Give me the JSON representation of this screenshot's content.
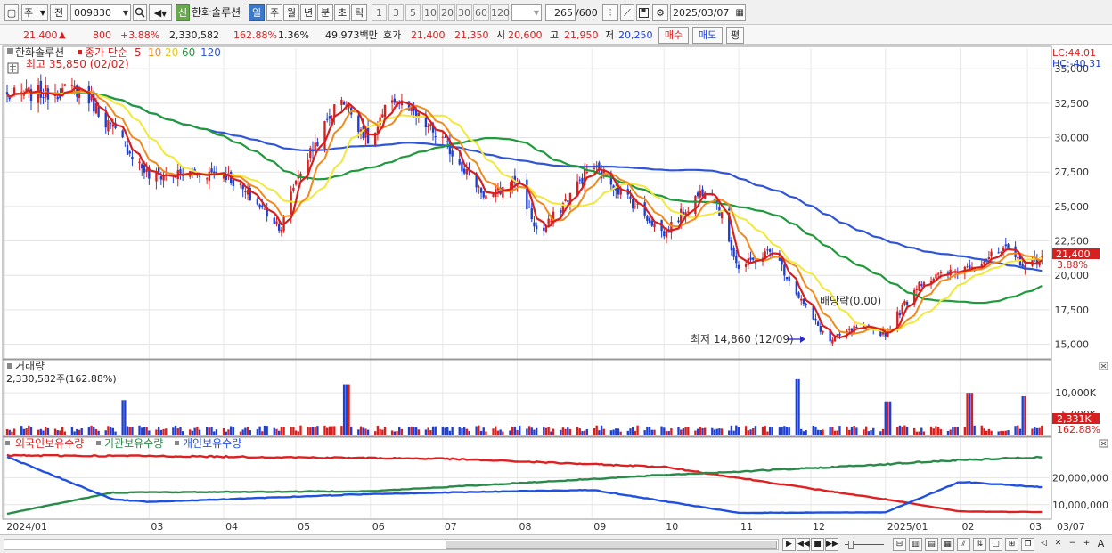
{
  "toolbar": {
    "period_select": "주",
    "prev_label": "전",
    "stock_code": "009830",
    "credit_badge": "신",
    "stock_name": "한화솔루션",
    "periods": [
      "일",
      "주",
      "월",
      "년",
      "분",
      "초",
      "틱"
    ],
    "active_period": "일",
    "intervals": [
      "1",
      "3",
      "5",
      "10",
      "20",
      "30",
      "60",
      "120"
    ],
    "count_value": "265",
    "count_total": "/600",
    "date": "2025/03/07"
  },
  "quote": {
    "price": "21,400",
    "change": "800",
    "change_pct": "+3.88%",
    "volume": "2,330,582",
    "volume_ratio": "162.88%",
    "turnover": "1.36%",
    "amount": "49,973백만",
    "bid_label": "호가",
    "bid1": "21,400",
    "bid2": "21,350",
    "open_label": "시",
    "open": "20,600",
    "high_label": "고",
    "high": "21,950",
    "low_label": "저",
    "low": "20,250",
    "buy_label": "매수",
    "sell_label": "매도",
    "eval_label": "평"
  },
  "price_panel": {
    "stock_label": "한화솔루션",
    "ma_label": "종가 단순",
    "ma_periods": [
      "5",
      "10",
      "20",
      "60",
      "120"
    ],
    "high_label": "최고 35,850 (02/02)",
    "low_label": "최저 14,860 (12/09)",
    "dividend_label": "배당락(0.00)",
    "lc_label": "LC:44.01",
    "hc_label": "HC:-40.31",
    "price_tag": "21,400",
    "pct_tag": "3.88%",
    "y_ticks": [
      "35,000",
      "32,500",
      "30,000",
      "27,500",
      "25,000",
      "22,500",
      "20,000",
      "17,500",
      "15,000"
    ]
  },
  "volume_panel": {
    "title": "거래량",
    "value_label": "2,330,582주(162.88%)",
    "y_ticks": [
      "10,000K",
      "5,000K"
    ],
    "tag": "2,331K",
    "tag_pct": "162.88%"
  },
  "holding_panel": {
    "series": [
      "외국인보유수량",
      "기관보유수량",
      "개인보유수량"
    ],
    "y_ticks": [
      "20,000,000",
      "10,000,000"
    ]
  },
  "x_axis": {
    "labels": [
      "2024/01",
      "03",
      "04",
      "05",
      "06",
      "07",
      "08",
      "09",
      "10",
      "11",
      "12",
      "2025/01",
      "02",
      "03",
      "03/07"
    ]
  },
  "colors": {
    "up": "#d62020",
    "down": "#1e3fd0",
    "ma5": "#d62020",
    "ma10": "#f08a1c",
    "ma20": "#f2e83a",
    "ma60": "#1f9a3c",
    "ma120": "#3055d6",
    "foreign": "#e02020",
    "institution": "#2a8a4a",
    "individual": "#2050e0"
  },
  "chart_data": [
    {
      "type": "candlestick",
      "title": "한화솔루션",
      "xlabel": "",
      "ylabel": "",
      "ylim": [
        14000,
        36500
      ],
      "grid": true,
      "anchors": {
        "dates": [
          "2024/01",
          "2024/02/02",
          "2024/03",
          "2024/04",
          "2024/04/25",
          "2024/05",
          "2024/05/20",
          "2024/06",
          "2024/06/10",
          "2024/07",
          "2024/07/20",
          "2024/08",
          "2024/08/10",
          "2024/09",
          "2024/09/15",
          "2024/10",
          "2024/10/20",
          "2024/11",
          "2024/11/15",
          "2024/12",
          "2024/12/09",
          "2024/12/20",
          "2025/01",
          "2025/01/15",
          "2025/02",
          "2025/02/20",
          "2025/03",
          "2025/03/07"
        ],
        "close": [
          33000,
          33500,
          27200,
          27500,
          23500,
          27000,
          33000,
          29500,
          33000,
          29800,
          25500,
          27000,
          22800,
          28000,
          25800,
          23000,
          26800,
          20500,
          21800,
          17000,
          15200,
          16200,
          15800,
          19500,
          20400,
          21800,
          20600,
          21400
        ]
      },
      "ma_periods": [
        5,
        10,
        20,
        60,
        120
      ]
    },
    {
      "type": "bar",
      "title": "거래량",
      "units": "K",
      "ylim": [
        0,
        14000
      ],
      "spikes": [
        {
          "date": "2024/02/19",
          "value": 8300
        },
        {
          "date": "2024/05/22",
          "value": 12000
        },
        {
          "date": "2024/11/25",
          "value": 13200
        },
        {
          "date": "2025/01/02",
          "value": 8000
        },
        {
          "date": "2025/02/05",
          "value": 10000
        },
        {
          "date": "2025/02/28",
          "value": 9200
        }
      ],
      "last": 2331
    },
    {
      "type": "line",
      "series": [
        {
          "name": "외국인보유수량",
          "x": [
            "2024/01",
            "2024/03",
            "2024/07",
            "2024/10",
            "2024/12",
            "2025/01",
            "2025/02",
            "2025/03/07"
          ],
          "values": [
            28200000,
            28000000,
            27000000,
            24000000,
            16000000,
            12000000,
            7500000,
            7300000
          ]
        },
        {
          "name": "기관보유수량",
          "x": [
            "2024/01",
            "2024/02/15",
            "2024/03",
            "2024/06",
            "2024/10",
            "2024/12",
            "2025/02",
            "2025/03/07"
          ],
          "values": [
            6500000,
            14500000,
            14600000,
            15000000,
            21000000,
            23500000,
            26500000,
            27500000
          ]
        },
        {
          "name": "개인보유수량",
          "x": [
            "2024/01",
            "2024/02/15",
            "2024/03",
            "2024/06",
            "2024/09",
            "2024/11",
            "2025/01",
            "2025/02",
            "2025/03/07"
          ],
          "values": [
            28000000,
            12000000,
            11000000,
            14000000,
            15500000,
            7000000,
            7200000,
            18500000,
            16500000
          ]
        }
      ],
      "y_ticks": [
        20000000,
        10000000
      ]
    }
  ]
}
